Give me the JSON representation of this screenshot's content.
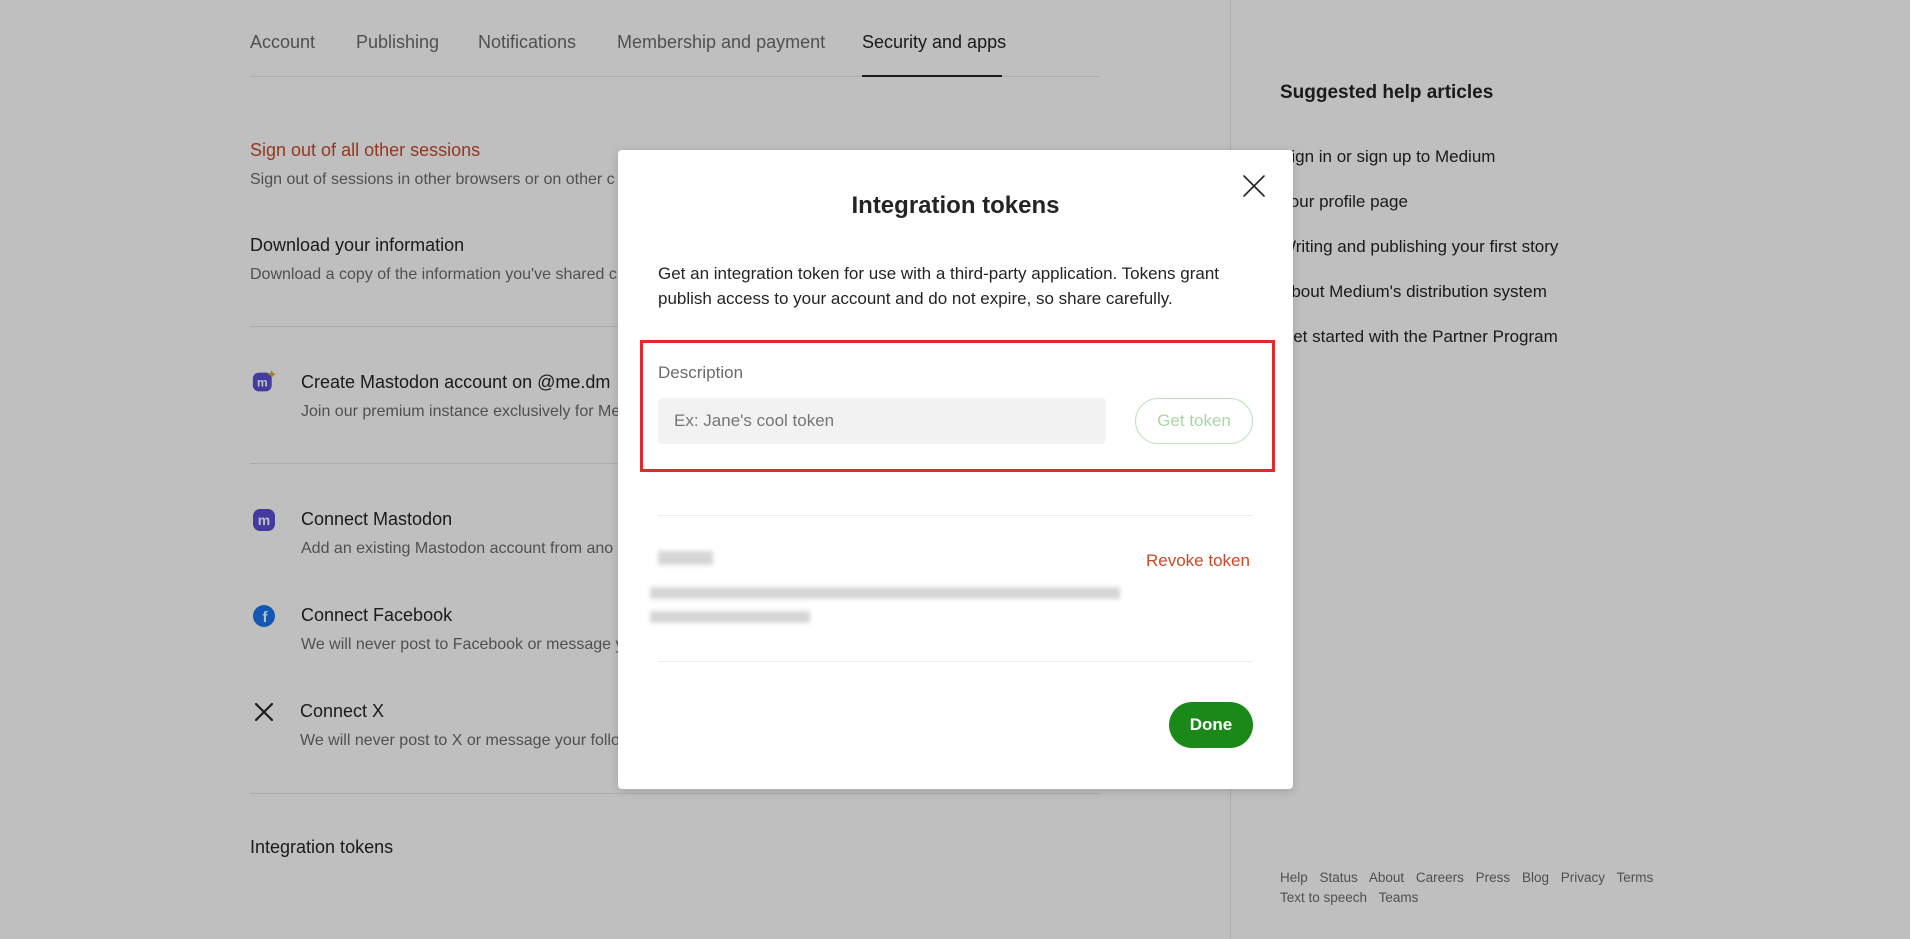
{
  "tabs": [
    {
      "label": "Account"
    },
    {
      "label": "Publishing"
    },
    {
      "label": "Notifications"
    },
    {
      "label": "Membership and payment"
    },
    {
      "label": "Security and apps"
    }
  ],
  "main": {
    "sign_out_title": "Sign out of all other sessions",
    "sign_out_sub": "Sign out of sessions in other browsers or on other c",
    "download_title": "Download your information",
    "download_sub": "Download a copy of the information you've shared c",
    "mastodon_create_title": "Create Mastodon account on @me.dm",
    "mastodon_create_sub": "Join our premium instance exclusively for Me",
    "mastodon_connect_title": "Connect Mastodon",
    "mastodon_connect_sub": "Add an existing Mastodon account from ano",
    "facebook_title": "Connect Facebook",
    "facebook_sub": "We will never post to Facebook or message y",
    "x_title": "Connect X",
    "x_sub": "We will never post to X or message your follo",
    "integration_tokens": "Integration tokens"
  },
  "help": {
    "title": "Suggested help articles",
    "links": [
      "Sign in or sign up to Medium",
      "Your profile page",
      "Writing and publishing your first story",
      "About Medium's distribution system",
      "Get started with the Partner Program"
    ]
  },
  "footer": {
    "row1": [
      "Help",
      "Status",
      "About",
      "Careers",
      "Press",
      "Blog",
      "Privacy",
      "Terms"
    ],
    "row2": [
      "Text to speech",
      "Teams"
    ]
  },
  "modal": {
    "title": "Integration tokens",
    "description": "Get an integration token for use with a third-party application. Tokens grant publish access to your account and do not expire, so share carefully.",
    "field_label": "Description",
    "input_placeholder": "Ex: Jane's cool token",
    "input_value": "",
    "get_token_label": "Get token",
    "revoke_label": "Revoke token",
    "done_label": "Done"
  },
  "colors": {
    "accent_green": "#1a8917",
    "danger_red": "#c94a29",
    "highlight_red": "#e62828",
    "mastodon_purple": "#5b4fd6",
    "facebook_blue": "#1877f2"
  }
}
